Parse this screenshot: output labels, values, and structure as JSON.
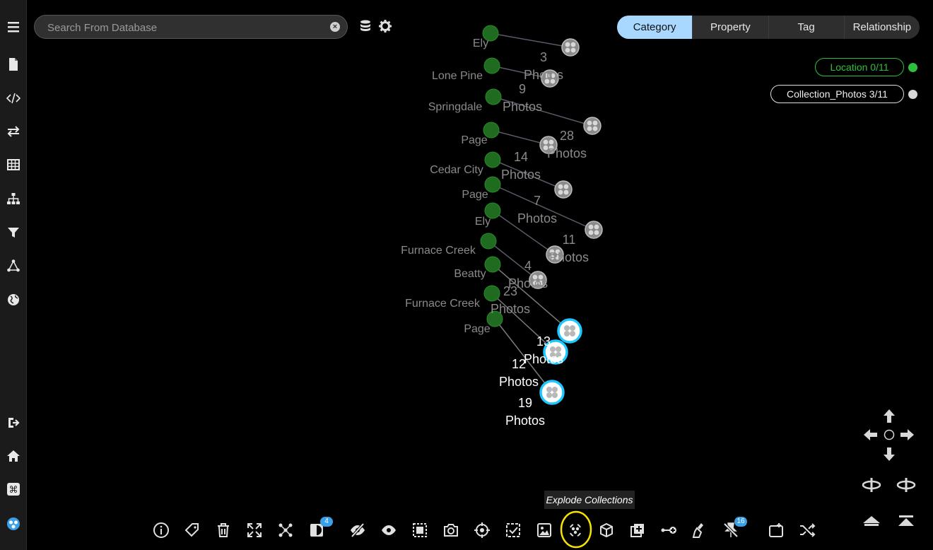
{
  "search": {
    "placeholder": "Search From Database"
  },
  "tabs": [
    "Category",
    "Property",
    "Tag",
    "Relationship"
  ],
  "legend": {
    "location": "Location 0/11",
    "collection": "Collection_Photos 3/11",
    "location_color": "#2fbf3f",
    "collection_color": "#d8d8d8"
  },
  "graph": {
    "locations": [
      {
        "label": "Ely"
      },
      {
        "label": "Lone Pine"
      },
      {
        "label": "Springdale"
      },
      {
        "label": "Page"
      },
      {
        "label": "Cedar City"
      },
      {
        "label": "Page"
      },
      {
        "label": "Ely"
      },
      {
        "label": "Furnace Creek"
      },
      {
        "label": "Beatty"
      },
      {
        "label": "Furnace Creek"
      },
      {
        "label": "Page"
      }
    ],
    "collections": [
      {
        "count": "",
        "unit": ""
      },
      {
        "count": "3",
        "unit": "Photos"
      },
      {
        "count": "9",
        "unit": "Photos"
      },
      {
        "count": "28",
        "unit": "Photos"
      },
      {
        "count": "14",
        "unit": "Photos"
      },
      {
        "count": "7",
        "unit": "Photos"
      },
      {
        "count": "11",
        "unit": "Photos"
      },
      {
        "count": "4",
        "unit": "Photos"
      },
      {
        "count": "23",
        "unit": "Photos"
      },
      {
        "count": "13",
        "unit": "Photos"
      },
      {
        "count": "12",
        "unit": "Photos"
      },
      {
        "count": "19",
        "unit": "Photos"
      }
    ],
    "node_color": "#1f6b1f",
    "collection_color": "#8a8a8a",
    "highlight_color": "#1ec8ff"
  },
  "toolbar": {
    "tooltip": "Explode Collections",
    "badge_layers": "4",
    "badge_pins": "16"
  }
}
